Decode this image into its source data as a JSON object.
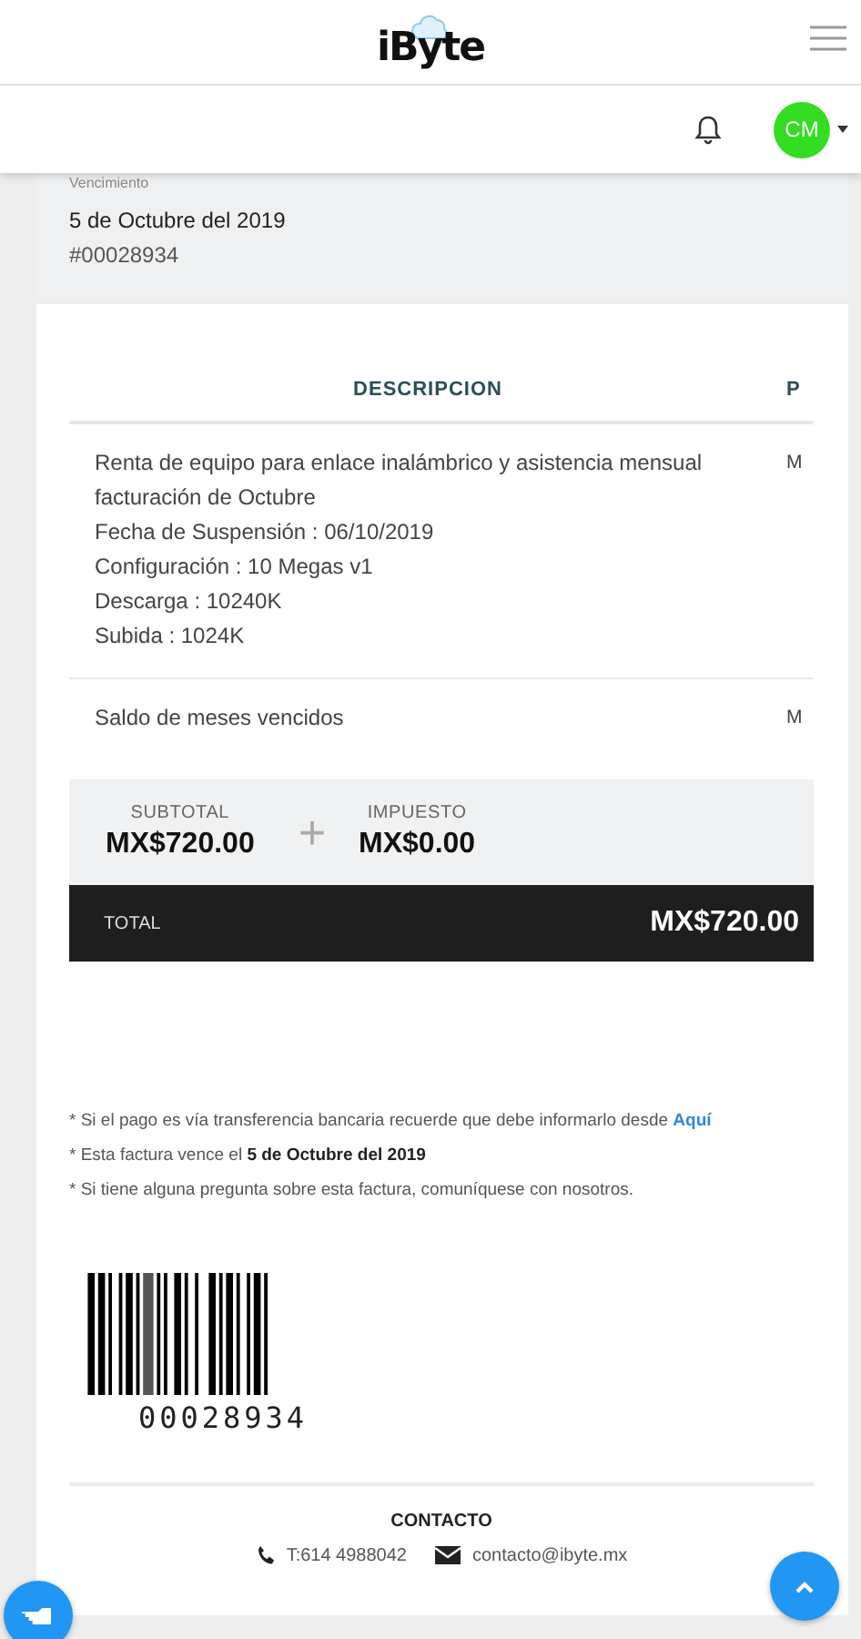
{
  "header": {
    "logo": "iByte"
  },
  "toolbar": {
    "avatar": {
      "initials": "CM"
    }
  },
  "invoice": {
    "due_label": "Vencimiento",
    "due_date": "5 de Octubre del 2019",
    "number": "#00028934"
  },
  "table": {
    "columns": [
      "DESCRIPCION",
      "P"
    ],
    "rows": [
      {
        "description": [
          "Renta de equipo para enlace inalámbrico y asistencia mensual",
          "facturación de Octubre",
          "Fecha de Suspensión : 06/10/2019",
          "Configuración : 10 Megas v1",
          "Descarga : 10240K",
          "Subida : 1024K"
        ],
        "column_2": "M"
      },
      {
        "description": [
          "Saldo de meses vencidos"
        ],
        "column_2": "M"
      }
    ]
  },
  "totals": {
    "subtotal_label": "SUBTOTAL",
    "subtotal": "MX$720.00",
    "operator": "+",
    "tax_label": "IMPUESTO",
    "tax": "MX$0.00",
    "total_label": "TOTAL",
    "total": "MX$720.00"
  },
  "notes": [
    {
      "text": "* Si el pago es vía transferencia bancaria recuerde que debe informarlo desde ",
      "link": "Aquí"
    },
    {
      "text": "* Esta factura vence el **5 de Octubre del 2019**"
    },
    {
      "text": "* Si tiene alguna pregunta sobre esta factura, comuníquese con nosotros."
    }
  ],
  "barcode": {
    "number": "00028934"
  },
  "contact": {
    "title": "CONTACTO",
    "phone": "T:614 4988042",
    "email": "contacto@ibyte.mx"
  }
}
